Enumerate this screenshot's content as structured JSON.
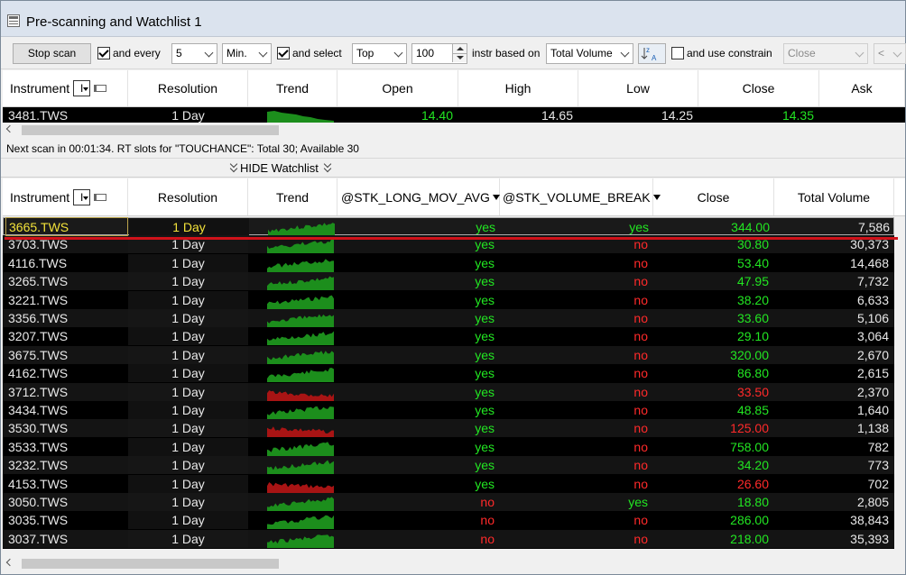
{
  "window": {
    "title": "Pre-scanning and Watchlist 1",
    "icon": "window-app-icon"
  },
  "toolbar": {
    "stop_scan": "Stop scan",
    "and_every_checked": true,
    "and_every_label": "and every",
    "interval_value": "5",
    "interval_unit": "Min.",
    "and_select_checked": true,
    "and_select_label": "and select",
    "select_mode": "Top",
    "select_count": "100",
    "based_on_label": "instr based on",
    "based_on_field": "Total Volume",
    "sort_icon": "sort-az-icon",
    "use_constrain_checked": false,
    "use_constrain_label": "and use constrain",
    "constrain_field": "Close",
    "constrain_op": "<"
  },
  "scanner": {
    "columns": [
      "Instrument",
      "Resolution",
      "Trend",
      "Open",
      "High",
      "Low",
      "Close",
      "Ask"
    ],
    "instrument_menu": "I",
    "rows": [
      {
        "instrument": "3481.TWS",
        "resolution": "1 Day",
        "open": "14.40",
        "high": "14.65",
        "low": "14.25",
        "close": "14.35"
      }
    ]
  },
  "status": "Next scan in 00:01:34. RT slots for \"TOUCHANCE\": Total 30; Available 30",
  "hide_watchlist": "HIDE Watchlist",
  "watchlist": {
    "columns": [
      "Instrument",
      "Resolution",
      "Trend",
      "@STK_LONG_MOV_AVG",
      "@STK_VOLUME_BREAK",
      "Close",
      "Total Volume"
    ],
    "instrument_menu": "I",
    "rows": [
      {
        "instrument": "3665.TWS",
        "resolution": "1 Day",
        "mov": "yes",
        "vol": "yes",
        "close": "344.00",
        "total": "7,586",
        "trend": "up",
        "close_color": "green"
      },
      {
        "instrument": "3703.TWS",
        "resolution": "1 Day",
        "mov": "yes",
        "vol": "no",
        "close": "30.80",
        "total": "30,373",
        "trend": "up",
        "close_color": "green"
      },
      {
        "instrument": "4116.TWS",
        "resolution": "1 Day",
        "mov": "yes",
        "vol": "no",
        "close": "53.40",
        "total": "14,468",
        "trend": "up",
        "close_color": "green"
      },
      {
        "instrument": "3265.TWS",
        "resolution": "1 Day",
        "mov": "yes",
        "vol": "no",
        "close": "47.95",
        "total": "7,732",
        "trend": "up",
        "close_color": "green"
      },
      {
        "instrument": "3221.TWS",
        "resolution": "1 Day",
        "mov": "yes",
        "vol": "no",
        "close": "38.20",
        "total": "6,633",
        "trend": "up",
        "close_color": "green"
      },
      {
        "instrument": "3356.TWS",
        "resolution": "1 Day",
        "mov": "yes",
        "vol": "no",
        "close": "33.60",
        "total": "5,106",
        "trend": "up",
        "close_color": "green"
      },
      {
        "instrument": "3207.TWS",
        "resolution": "1 Day",
        "mov": "yes",
        "vol": "no",
        "close": "29.10",
        "total": "3,064",
        "trend": "up",
        "close_color": "green"
      },
      {
        "instrument": "3675.TWS",
        "resolution": "1 Day",
        "mov": "yes",
        "vol": "no",
        "close": "320.00",
        "total": "2,670",
        "trend": "up",
        "close_color": "green"
      },
      {
        "instrument": "4162.TWS",
        "resolution": "1 Day",
        "mov": "yes",
        "vol": "no",
        "close": "86.80",
        "total": "2,615",
        "trend": "up",
        "close_color": "green"
      },
      {
        "instrument": "3712.TWS",
        "resolution": "1 Day",
        "mov": "yes",
        "vol": "no",
        "close": "33.50",
        "total": "2,370",
        "trend": "down",
        "close_color": "red"
      },
      {
        "instrument": "3434.TWS",
        "resolution": "1 Day",
        "mov": "yes",
        "vol": "no",
        "close": "48.85",
        "total": "1,640",
        "trend": "up",
        "close_color": "green"
      },
      {
        "instrument": "3530.TWS",
        "resolution": "1 Day",
        "mov": "yes",
        "vol": "no",
        "close": "125.00",
        "total": "1,138",
        "trend": "down",
        "close_color": "red"
      },
      {
        "instrument": "3533.TWS",
        "resolution": "1 Day",
        "mov": "yes",
        "vol": "no",
        "close": "758.00",
        "total": "782",
        "trend": "up",
        "close_color": "green"
      },
      {
        "instrument": "3232.TWS",
        "resolution": "1 Day",
        "mov": "yes",
        "vol": "no",
        "close": "34.20",
        "total": "773",
        "trend": "up",
        "close_color": "green"
      },
      {
        "instrument": "4153.TWS",
        "resolution": "1 Day",
        "mov": "yes",
        "vol": "no",
        "close": "26.60",
        "total": "702",
        "trend": "down",
        "close_color": "red"
      },
      {
        "instrument": "3050.TWS",
        "resolution": "1 Day",
        "mov": "no",
        "vol": "yes",
        "close": "18.80",
        "total": "2,805",
        "trend": "up",
        "close_color": "green"
      },
      {
        "instrument": "3035.TWS",
        "resolution": "1 Day",
        "mov": "no",
        "vol": "no",
        "close": "286.00",
        "total": "38,843",
        "trend": "up",
        "close_color": "green"
      },
      {
        "instrument": "3037.TWS",
        "resolution": "1 Day",
        "mov": "no",
        "vol": "no",
        "close": "218.00",
        "total": "35,393",
        "trend": "up",
        "close_color": "green"
      }
    ]
  },
  "colors": {
    "positive": "#22e622",
    "negative": "#ff2a2a",
    "yellow": "#f2e23a",
    "trend_up": "#1c8e1c",
    "trend_down": "#a81414",
    "highlight_line": "#d0121a"
  }
}
